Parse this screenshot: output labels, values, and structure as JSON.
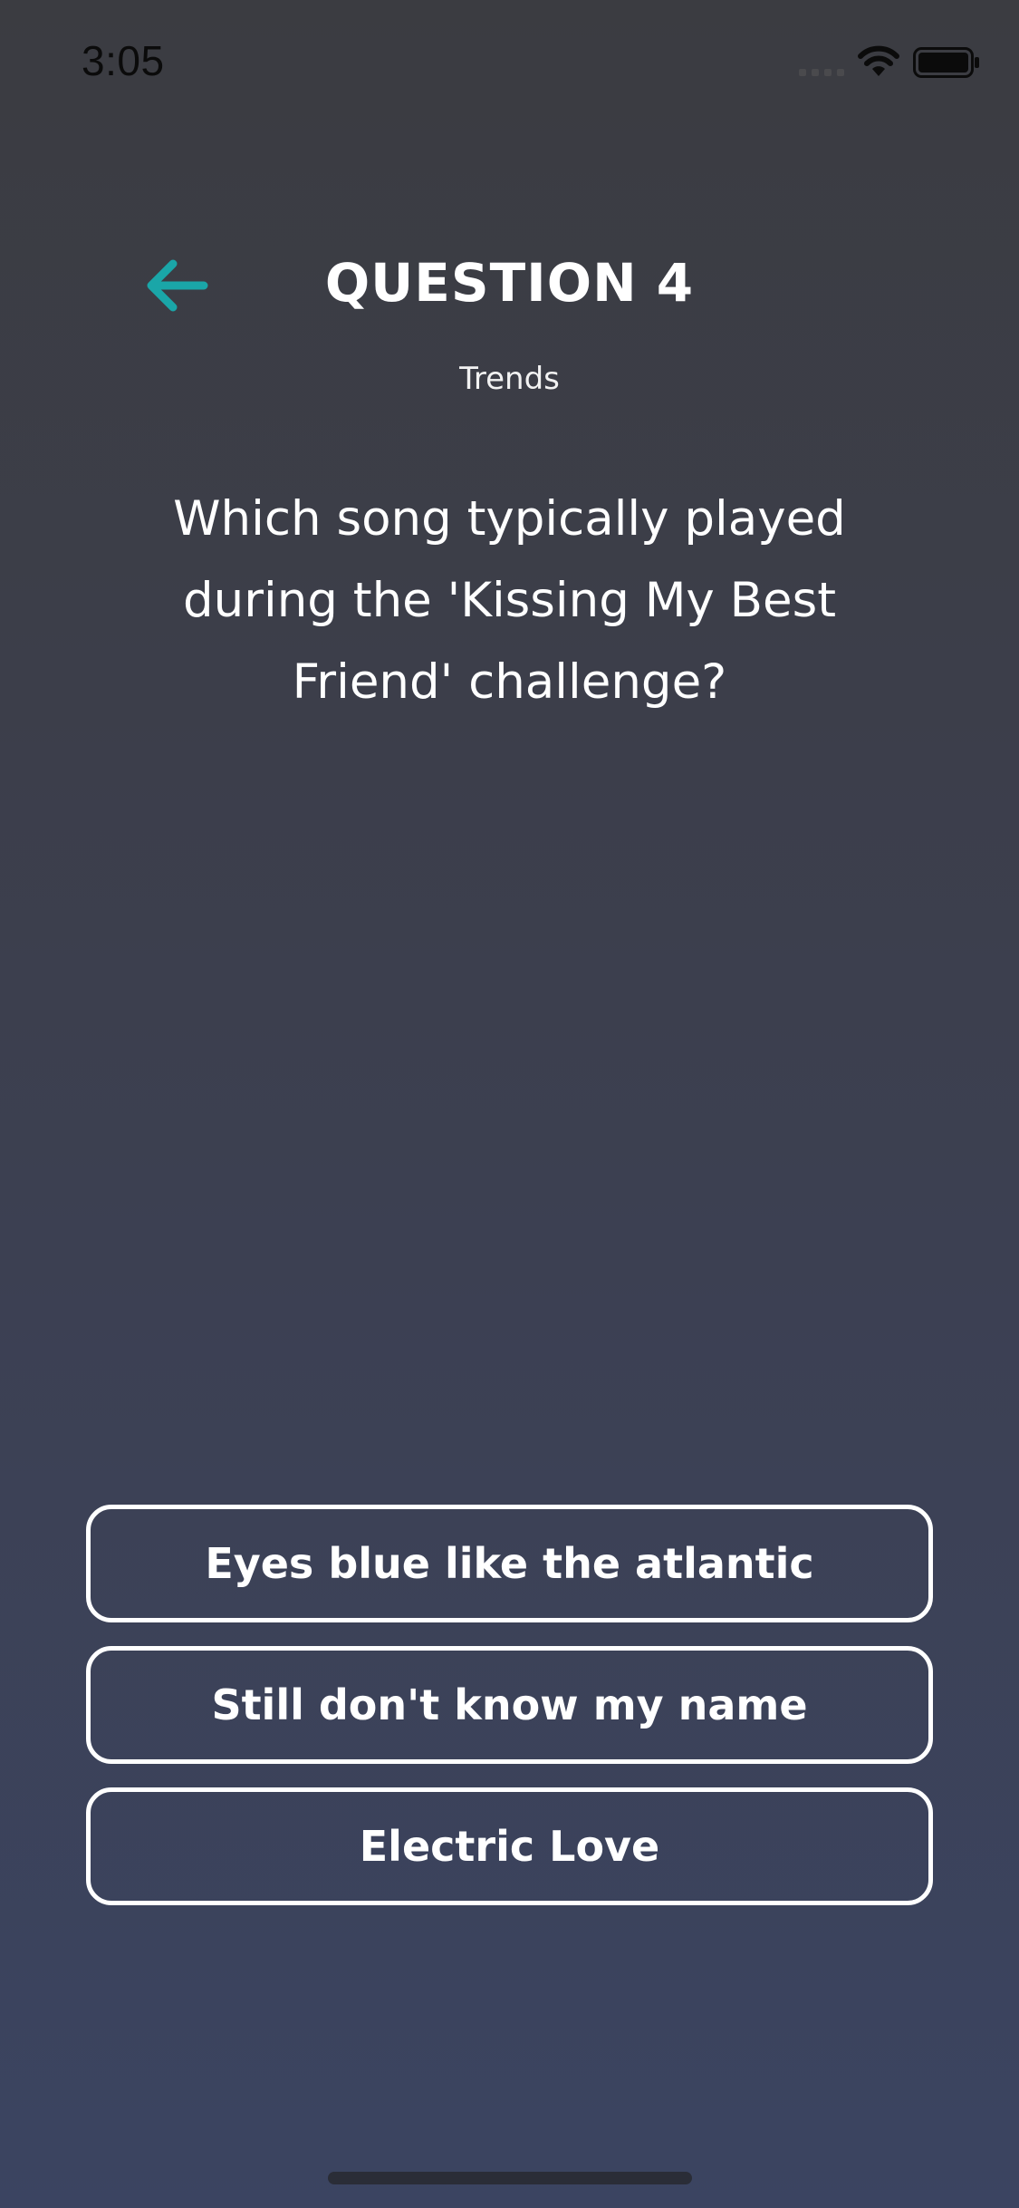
{
  "status_bar": {
    "time": "3:05",
    "signal_icon": "cellular-signal-icon",
    "wifi_icon": "wifi-icon",
    "battery_icon": "battery-icon"
  },
  "header": {
    "back_icon": "arrow-left-icon",
    "title": "QUESTION 4",
    "category": "Trends"
  },
  "question": {
    "text": "Which song typically played during the 'Kissing My Best Friend' challenge?"
  },
  "answers": [
    {
      "label": "Eyes blue like the atlantic"
    },
    {
      "label": "Still don't know my name"
    },
    {
      "label": "Electric Love"
    }
  ],
  "colors": {
    "accent": "#1aa6a8",
    "background_top": "#3b3c41",
    "background_bottom": "#3b4461",
    "text": "#ffffff"
  }
}
